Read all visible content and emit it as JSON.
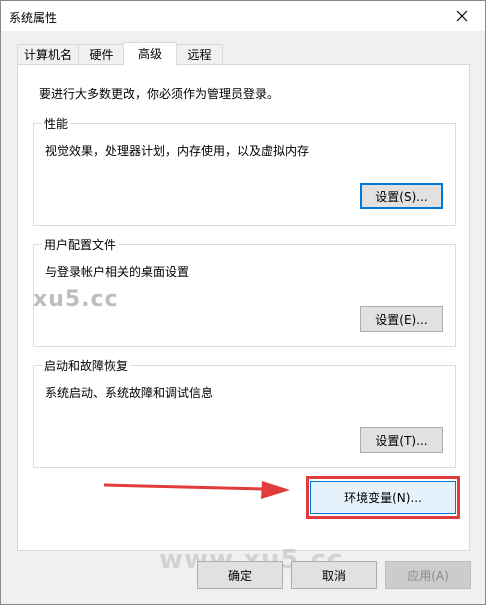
{
  "window": {
    "title": "系统属性"
  },
  "tabs": [
    {
      "label": "计算机名",
      "active": false
    },
    {
      "label": "硬件",
      "active": false
    },
    {
      "label": "高级",
      "active": true
    },
    {
      "label": "远程",
      "active": false
    }
  ],
  "advanced": {
    "admin_notice": "要进行大多数更改，你必须作为管理员登录。",
    "performance": {
      "title": "性能",
      "description": "视觉效果，处理器计划，内存使用，以及虚拟内存",
      "button": "设置(S)..."
    },
    "user_profiles": {
      "title": "用户配置文件",
      "description": "与登录帐户相关的桌面设置",
      "button": "设置(E)..."
    },
    "startup_recovery": {
      "title": "启动和故障恢复",
      "description": "系统启动、系统故障和调试信息",
      "button": "设置(T)..."
    },
    "env_button": "环境变量(N)..."
  },
  "footer": {
    "ok": "确定",
    "cancel": "取消",
    "apply": "应用(A)"
  },
  "watermarks": {
    "small": "xu5.cc",
    "large": "www.xu5.cc"
  },
  "colors": {
    "annotation_red": "#e23b3b",
    "focus_blue": "#0078d7"
  },
  "icons": {
    "close": "close-icon",
    "annotation_arrow": "arrow-right-icon"
  }
}
